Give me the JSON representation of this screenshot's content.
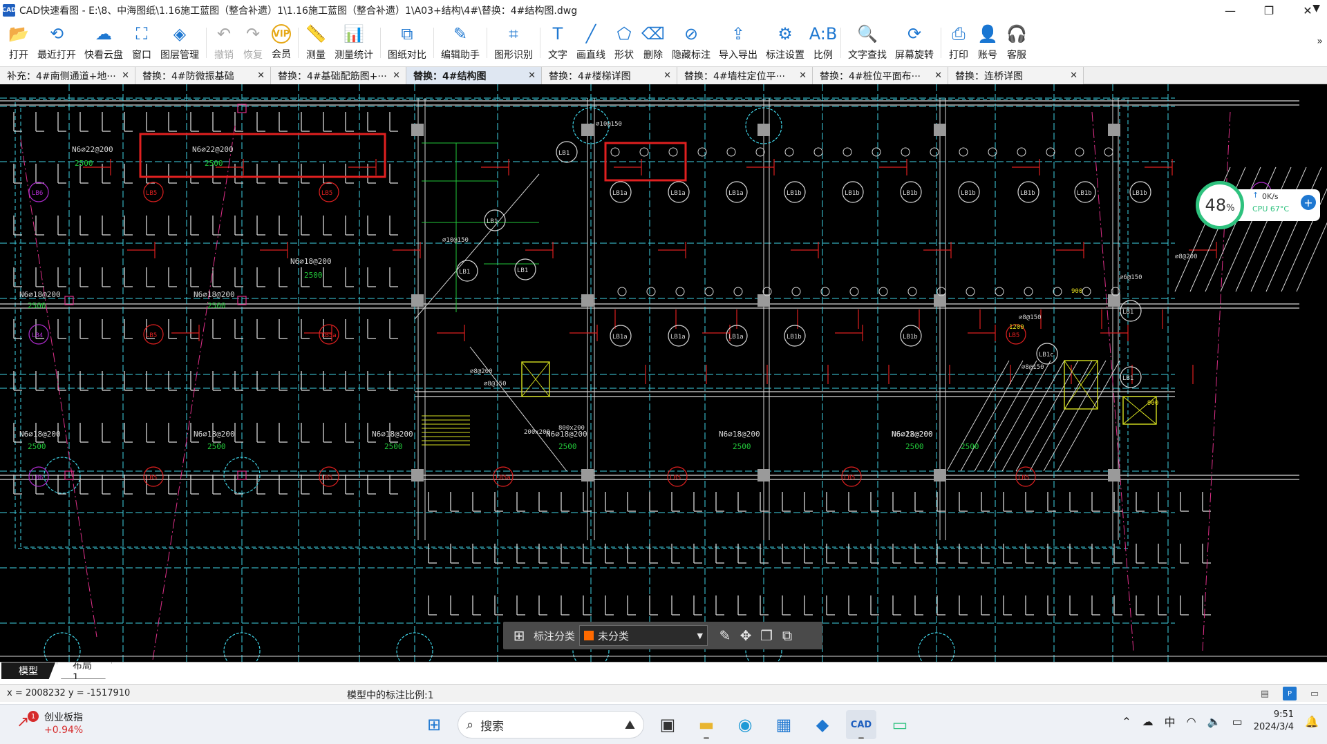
{
  "window": {
    "logo_text": "CAD",
    "title": "CAD快速看图 - E:\\8、中海图纸\\1.16施工蓝图（整合补遗）1\\1.16施工蓝图（整合补遗）1\\A03+结构\\4#\\替换：4#结构图.dwg",
    "controls": [
      "—",
      "❐",
      "✕"
    ]
  },
  "toolbar": {
    "tools": [
      {
        "label": "打开",
        "icon": "folder-open-icon",
        "glyph": "📂"
      },
      {
        "label": "最近打开",
        "icon": "history-icon",
        "glyph": "⟲"
      },
      {
        "label": "快看云盘",
        "icon": "cloud-icon",
        "glyph": "☁"
      },
      {
        "label": "窗口",
        "icon": "window-icon",
        "glyph": "⛶"
      },
      {
        "label": "图层管理",
        "icon": "layers-icon",
        "glyph": "◈"
      },
      {
        "label": "撤销",
        "icon": "undo-icon",
        "glyph": "↶"
      },
      {
        "label": "恢复",
        "icon": "redo-icon",
        "glyph": "↷"
      },
      {
        "label": "会员",
        "icon": "vip-icon",
        "glyph": "VIP"
      },
      {
        "label": "测量",
        "icon": "ruler-icon",
        "glyph": "📏"
      },
      {
        "label": "测量统计",
        "icon": "measure-stats-icon",
        "glyph": "📊"
      },
      {
        "label": "图纸对比",
        "icon": "compare-icon",
        "glyph": "⧉"
      },
      {
        "label": "编辑助手",
        "icon": "edit-assistant-icon",
        "glyph": "✎"
      },
      {
        "label": "图形识别",
        "icon": "shape-recognize-icon",
        "glyph": "⌗"
      },
      {
        "label": "文字",
        "icon": "text-icon",
        "glyph": "T"
      },
      {
        "label": "画直线",
        "icon": "line-icon",
        "glyph": "╱"
      },
      {
        "label": "形状",
        "icon": "shapes-icon",
        "glyph": "⬠"
      },
      {
        "label": "删除",
        "icon": "eraser-icon",
        "glyph": "⌫"
      },
      {
        "label": "隐藏标注",
        "icon": "hide-annotation-icon",
        "glyph": "⊘"
      },
      {
        "label": "导入导出",
        "icon": "import-export-icon",
        "glyph": "⇪"
      },
      {
        "label": "标注设置",
        "icon": "annotation-settings-icon",
        "glyph": "⚙"
      },
      {
        "label": "比例",
        "icon": "scale-icon",
        "glyph": "A:B"
      },
      {
        "label": "文字查找",
        "icon": "text-search-icon",
        "glyph": "🔍"
      },
      {
        "label": "屏幕旋转",
        "icon": "rotate-screen-icon",
        "glyph": "⟳"
      },
      {
        "label": "打印",
        "icon": "print-icon",
        "glyph": "⎙"
      },
      {
        "label": "账号",
        "icon": "account-icon",
        "glyph": "👤"
      },
      {
        "label": "客服",
        "icon": "headset-icon",
        "glyph": "🎧"
      }
    ],
    "more": "»"
  },
  "tabs": [
    {
      "label": "补充：4#南侧通道+地···",
      "active": false
    },
    {
      "label": "替换：4#防微振基础",
      "active": false
    },
    {
      "label": "替换：4#基础配筋图+···",
      "active": false
    },
    {
      "label": "替换：4#结构图",
      "active": true
    },
    {
      "label": "替换：4#楼梯详图",
      "active": false
    },
    {
      "label": "替换：4#墙柱定位平···",
      "active": false
    },
    {
      "label": "替换：4#桩位平面布···",
      "active": false
    },
    {
      "label": "替换：连桥详图",
      "active": false
    }
  ],
  "tab_close": "✕",
  "tab_overflow": "▼",
  "cad": {
    "labels_white": [
      "N6⌀22@200",
      "N6⌀22@200",
      "N6⌀18@200",
      "N6⌀18@200",
      "N6⌀18@200",
      "N6⌀18@200",
      "N6⌀18@200",
      "N6⌀18@200",
      "N6⌀18@200",
      "N6⌀18@200",
      "N6⌀18@200",
      "N6⌀22@200"
    ],
    "labels_green": [
      "2500",
      "2500",
      "2500",
      "2500",
      "2500",
      "2500",
      "2500",
      "2500",
      "2500",
      "2500",
      "2500",
      "2500"
    ],
    "slab_tags_red": [
      "LB5",
      "LB5",
      "LB5",
      "LB5a",
      "LB5",
      "LB5",
      "LB5a",
      "LB5",
      "LB5",
      "LB5",
      "LB5",
      "LB5a"
    ],
    "slab_tags_purple": [
      "LB6",
      "LB4",
      "LB6",
      "LB3"
    ],
    "slab_tags_white": [
      "LB1a",
      "LB1a",
      "LB1a",
      "LB1b",
      "LB1b",
      "LB1b",
      "LB1b",
      "LB1b",
      "LB1b",
      "LB1b",
      "LB1a",
      "LB1a",
      "LB1a",
      "LB1b",
      "LB1b",
      "LB1",
      "LB1",
      "LB1",
      "LB1",
      "LB1c",
      "LB1",
      "LB1"
    ],
    "rebar_small": [
      "⌀10@150",
      "⌀10@150",
      "⌀8@200",
      "⌀8@150",
      "⌀8@150",
      "⌀8@200",
      "⌀6@150",
      "⌀8@150",
      "900",
      "900",
      "1200",
      "200x200",
      "800x200"
    ]
  },
  "cpu_widget": {
    "percent": "48",
    "percent_unit": "%",
    "net_speed": "0K/s",
    "up_arrow": "↑",
    "temp": "CPU 67°C",
    "plus": "+"
  },
  "annotation_bar": {
    "label": "标注分类",
    "selected": "未分类",
    "swatch_color": "#ff6a00"
  },
  "layout_tabs": [
    "模型",
    "布局1"
  ],
  "statusbar": {
    "coords": "x = 2008232  y = -1517910",
    "scale_text": "模型中的标注比例:1"
  },
  "taskbar": {
    "stock_badge": "1",
    "stock_name": "创业板指",
    "stock_change": "+0.94%",
    "search_placeholder": "搜索",
    "ime": "中",
    "time": "9:51",
    "date": "2024/3/4"
  }
}
